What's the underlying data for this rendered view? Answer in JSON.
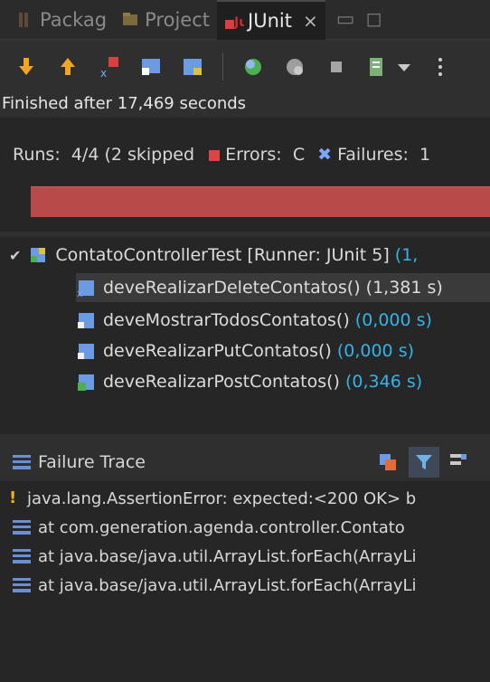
{
  "tabs": [
    {
      "label": "Packag",
      "active": false
    },
    {
      "label": "Project",
      "active": false
    },
    {
      "label": "JUnit",
      "active": true,
      "close": "⨯"
    }
  ],
  "status": "Finished after 17,469 seconds",
  "counters": {
    "runs_label": "Runs:",
    "runs_value": "4/4 (2 skipped",
    "errors_label": "Errors:",
    "errors_value": "C",
    "failures_label": "Failures:",
    "failures_value": "1"
  },
  "tree": {
    "root": {
      "label": "ContatoControllerTest [Runner: JUnit 5]",
      "time": "(1,"
    },
    "children": [
      {
        "name": "deveRealizarDeleteContatos()",
        "time": "(1,381 s)",
        "time_colored": false,
        "state": "failed"
      },
      {
        "name": "deveMostrarTodosContatos()",
        "time": "(0,000 s)",
        "time_colored": true,
        "state": "skipped"
      },
      {
        "name": "deveRealizarPutContatos()",
        "time": "(0,000 s)",
        "time_colored": true,
        "state": "skipped"
      },
      {
        "name": "deveRealizarPostContatos()",
        "time": "(0,346 s)",
        "time_colored": true,
        "state": "passed"
      }
    ]
  },
  "trace": {
    "title": "Failure Trace",
    "lines": [
      {
        "text": "java.lang.AssertionError: expected:<200 OK> b",
        "icon": "warning-icon"
      },
      {
        "text": "at com.generation.agenda.controller.Contato",
        "icon": "stack-frame-icon"
      },
      {
        "text": "at java.base/java.util.ArrayList.forEach(ArrayLi",
        "icon": "stack-frame-icon"
      },
      {
        "text": "at java.base/java.util.ArrayList.forEach(ArrayLi",
        "icon": "stack-frame-icon"
      }
    ]
  },
  "colors": {
    "failure_bar": "#b94a4a",
    "time_link": "#35b3e6",
    "error_red": "#dd4444",
    "failure_blue": "#7aa7ff"
  }
}
